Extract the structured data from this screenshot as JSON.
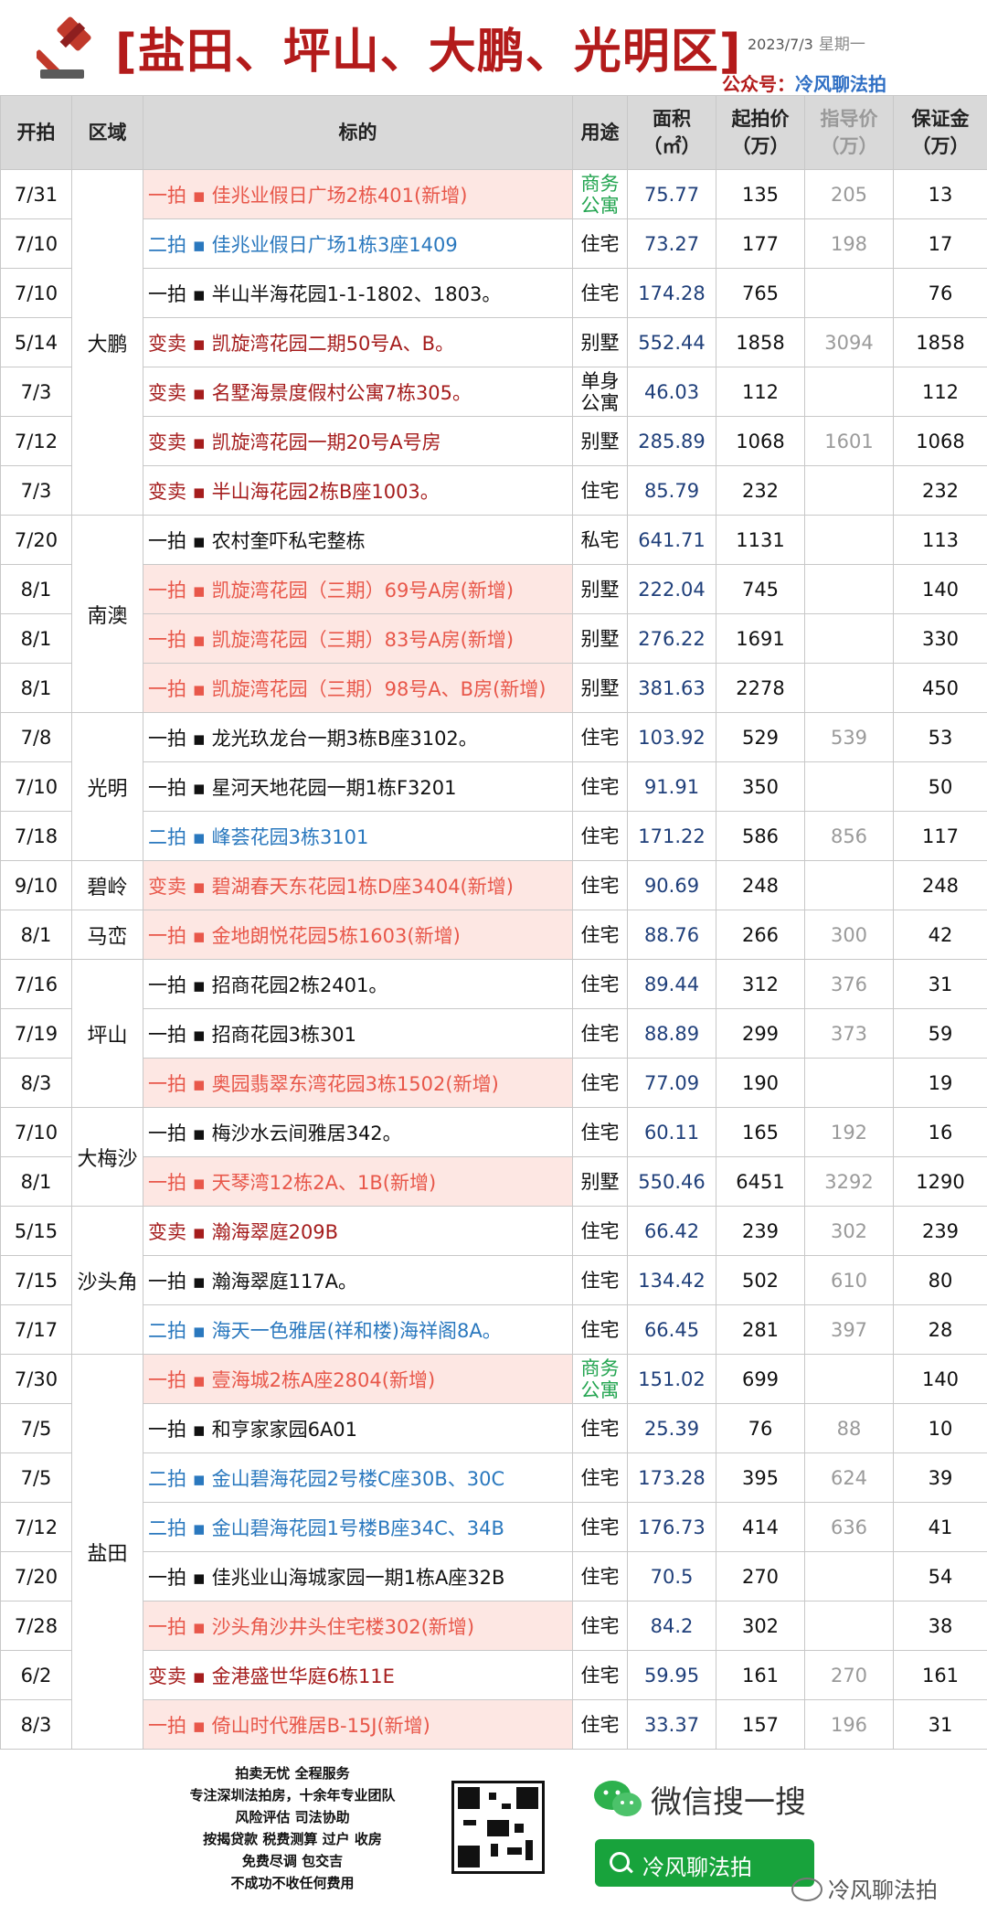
{
  "header": {
    "title": "[盐田、坪山、大鹏、光明区]",
    "date": "2023/7/3",
    "weekday": "星期一",
    "gzh_label": "公众号：",
    "gzh_name": "冷风聊法拍"
  },
  "columns": {
    "open": "开拍",
    "region": "区域",
    "subject": "标的",
    "use": "用途",
    "area_l1": "面积",
    "area_l2": "（㎡）",
    "start_l1": "起拍价",
    "start_l2": "（万）",
    "guide_l1": "指导价",
    "guide_l2": "（万）",
    "deposit_l1": "保证金",
    "deposit_l2": "（万）"
  },
  "regions": [
    {
      "name": "大鹏",
      "rows": [
        {
          "date": "7/31",
          "subject": "一拍 ▪ 佳兆业假日广场2栋401(新增)",
          "style": "new",
          "use": "商务\n公寓",
          "area": "75.77",
          "start": "135",
          "guide": "205",
          "deposit": "13"
        },
        {
          "date": "7/10",
          "subject": "二拍 ▪ 佳兆业假日广场1栋3座1409",
          "style": "blue",
          "use": "住宅",
          "area": "73.27",
          "start": "177",
          "guide": "198",
          "deposit": "17"
        },
        {
          "date": "7/10",
          "subject": "一拍 ▪ 半山半海花园1-1-1802、1803。",
          "style": "black",
          "use": "住宅",
          "area": "174.28",
          "start": "765",
          "guide": "",
          "deposit": "76"
        },
        {
          "date": "5/14",
          "subject": "变卖 ▪ 凯旋湾花园二期50号A、B。",
          "style": "red",
          "use": "别墅",
          "area": "552.44",
          "start": "1858",
          "guide": "3094",
          "deposit": "1858"
        },
        {
          "date": "7/3",
          "subject": "变卖 ▪ 名墅海景度假村公寓7栋305。",
          "style": "red",
          "use": "单身\n公寓",
          "area": "46.03",
          "start": "112",
          "guide": "",
          "deposit": "112"
        },
        {
          "date": "7/12",
          "subject": "变卖 ▪ 凯旋湾花园一期20号A号房",
          "style": "red",
          "use": "别墅",
          "area": "285.89",
          "start": "1068",
          "guide": "1601",
          "deposit": "1068"
        },
        {
          "date": "7/3",
          "subject": "变卖 ▪ 半山海花园2栋B座1003。",
          "style": "red",
          "use": "住宅",
          "area": "85.79",
          "start": "232",
          "guide": "",
          "deposit": "232"
        }
      ]
    },
    {
      "name": "南澳",
      "rows": [
        {
          "date": "7/20",
          "subject": "一拍 ▪ 农村奎吓私宅整栋",
          "style": "black",
          "use": "私宅",
          "area": "641.71",
          "start": "1131",
          "guide": "",
          "deposit": "113"
        },
        {
          "date": "8/1",
          "subject": "一拍 ▪ 凯旋湾花园（三期）69号A房(新增)",
          "style": "new",
          "use": "别墅",
          "area": "222.04",
          "start": "745",
          "guide": "",
          "deposit": "140"
        },
        {
          "date": "8/1",
          "subject": "一拍 ▪ 凯旋湾花园（三期）83号A房(新增)",
          "style": "new",
          "use": "别墅",
          "area": "276.22",
          "start": "1691",
          "guide": "",
          "deposit": "330"
        },
        {
          "date": "8/1",
          "subject": "一拍 ▪ 凯旋湾花园（三期）98号A、B房(新增)",
          "style": "new",
          "use": "别墅",
          "area": "381.63",
          "start": "2278",
          "guide": "",
          "deposit": "450"
        }
      ]
    },
    {
      "name": "光明",
      "rows": [
        {
          "date": "7/8",
          "subject": "一拍 ▪ 龙光玖龙台一期3栋B座3102。",
          "style": "black",
          "use": "住宅",
          "area": "103.92",
          "start": "529",
          "guide": "539",
          "deposit": "53"
        },
        {
          "date": "7/10",
          "subject": "一拍 ▪ 星河天地花园一期1栋F3201",
          "style": "black",
          "use": "住宅",
          "area": "91.91",
          "start": "350",
          "guide": "",
          "deposit": "50"
        },
        {
          "date": "7/18",
          "subject": "二拍 ▪ 峰荟花园3栋3101",
          "style": "blue",
          "use": "住宅",
          "area": "171.22",
          "start": "586",
          "guide": "856",
          "deposit": "117"
        }
      ]
    },
    {
      "name": "碧岭",
      "rows": [
        {
          "date": "9/10",
          "subject": "变卖 ▪ 碧湖春天东花园1栋D座3404(新增)",
          "style": "new",
          "use": "住宅",
          "area": "90.69",
          "start": "248",
          "guide": "",
          "deposit": "248"
        }
      ]
    },
    {
      "name": "马峦",
      "rows": [
        {
          "date": "8/1",
          "subject": "一拍 ▪ 金地朗悦花园5栋1603(新增)",
          "style": "new",
          "use": "住宅",
          "area": "88.76",
          "start": "266",
          "guide": "300",
          "deposit": "42"
        }
      ]
    },
    {
      "name": "坪山",
      "rows": [
        {
          "date": "7/16",
          "subject": "一拍 ▪ 招商花园2栋2401。",
          "style": "black",
          "use": "住宅",
          "area": "89.44",
          "start": "312",
          "guide": "376",
          "deposit": "31"
        },
        {
          "date": "7/19",
          "subject": "一拍 ▪ 招商花园3栋301",
          "style": "black",
          "use": "住宅",
          "area": "88.89",
          "start": "299",
          "guide": "373",
          "deposit": "59"
        },
        {
          "date": "8/3",
          "subject": "一拍 ▪ 奥园翡翠东湾花园3栋1502(新增)",
          "style": "new",
          "use": "住宅",
          "area": "77.09",
          "start": "190",
          "guide": "",
          "deposit": "19"
        }
      ]
    },
    {
      "name": "大梅沙",
      "rows": [
        {
          "date": "7/10",
          "subject": "一拍 ▪ 梅沙水云间雅居342。",
          "style": "black",
          "use": "住宅",
          "area": "60.11",
          "start": "165",
          "guide": "192",
          "deposit": "16"
        },
        {
          "date": "8/1",
          "subject": "一拍 ▪ 天琴湾12栋2A、1B(新增)",
          "style": "new",
          "use": "别墅",
          "area": "550.46",
          "start": "6451",
          "guide": "3292",
          "deposit": "1290"
        }
      ]
    },
    {
      "name": "沙头角",
      "rows": [
        {
          "date": "5/15",
          "subject": "变卖 ▪ 瀚海翠庭209B",
          "style": "red",
          "use": "住宅",
          "area": "66.42",
          "start": "239",
          "guide": "302",
          "deposit": "239"
        },
        {
          "date": "7/15",
          "subject": "一拍 ▪ 瀚海翠庭117A。",
          "style": "black",
          "use": "住宅",
          "area": "134.42",
          "start": "502",
          "guide": "610",
          "deposit": "80"
        },
        {
          "date": "7/17",
          "subject": "二拍 ▪ 海天一色雅居(祥和楼)海祥阁8A。",
          "style": "blue",
          "use": "住宅",
          "area": "66.45",
          "start": "281",
          "guide": "397",
          "deposit": "28"
        }
      ]
    },
    {
      "name": "盐田",
      "rows": [
        {
          "date": "7/30",
          "subject": "一拍 ▪ 壹海城2栋A座2804(新增)",
          "style": "new",
          "use": "商务\n公寓",
          "area": "151.02",
          "start": "699",
          "guide": "",
          "deposit": "140"
        },
        {
          "date": "7/5",
          "subject": "一拍 ▪ 和亨家家园6A01",
          "style": "black",
          "use": "住宅",
          "area": "25.39",
          "start": "76",
          "guide": "88",
          "deposit": "10"
        },
        {
          "date": "7/5",
          "subject": "二拍 ▪ 金山碧海花园2号楼C座30B、30C",
          "style": "blue",
          "use": "住宅",
          "area": "173.28",
          "start": "395",
          "guide": "624",
          "deposit": "39"
        },
        {
          "date": "7/12",
          "subject": "二拍 ▪ 金山碧海花园1号楼B座34C、34B",
          "style": "blue",
          "use": "住宅",
          "area": "176.73",
          "start": "414",
          "guide": "636",
          "deposit": "41"
        },
        {
          "date": "7/20",
          "subject": "一拍 ▪ 佳兆业山海城家园一期1栋A座32B",
          "style": "black",
          "use": "住宅",
          "area": "70.5",
          "start": "270",
          "guide": "",
          "deposit": "54"
        },
        {
          "date": "7/28",
          "subject": "一拍 ▪ 沙头角沙井头住宅楼302(新增)",
          "style": "new",
          "use": "住宅",
          "area": "84.2",
          "start": "302",
          "guide": "",
          "deposit": "38"
        },
        {
          "date": "6/2",
          "subject": "变卖 ▪ 金港盛世华庭6栋11E",
          "style": "red",
          "use": "住宅",
          "area": "59.95",
          "start": "161",
          "guide": "270",
          "deposit": "161"
        },
        {
          "date": "8/3",
          "subject": "一拍 ▪ 倚山时代雅居B-15J(新增)",
          "style": "new",
          "use": "住宅",
          "area": "33.37",
          "start": "157",
          "guide": "196",
          "deposit": "31"
        }
      ]
    }
  ],
  "footer": {
    "slogan": [
      "拍卖无忧 全程服务",
      "专注深圳法拍房，十余年专业团队",
      "风险评估 司法协助",
      "按揭贷款 税费测算 过户 收房",
      "免费尽调  包交吉",
      "不成功不收任何费用"
    ],
    "search_text": "微信搜一搜",
    "search_button": "冷风聊法拍",
    "watermark": "冷风聊法拍"
  },
  "colors": {
    "title_red": "#b31b1b",
    "new_bg": "#fde7e3",
    "new_text": "#e8574a",
    "blue_text": "#2a78be",
    "red_text": "#a51d1d",
    "area_text": "#1f3f7a",
    "guide_text": "#9a9a9a",
    "biz_green": "#24a551",
    "wechat_green": "#18a33c"
  }
}
